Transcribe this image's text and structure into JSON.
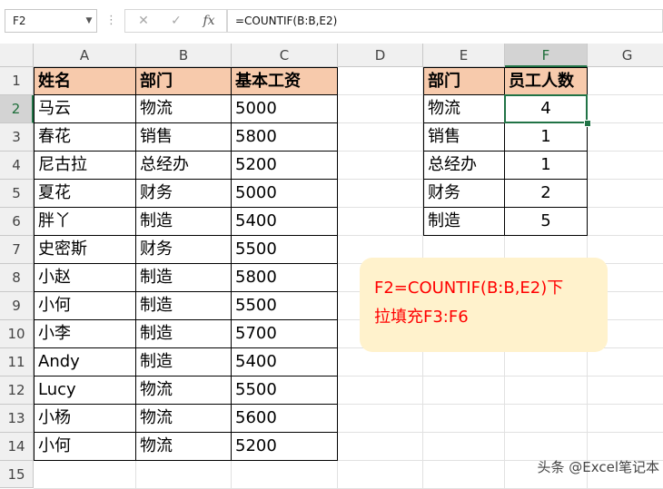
{
  "name_box": "F2",
  "formula_bar": {
    "cancel_icon": "✕",
    "enter_icon": "✓",
    "fx_label": "fx",
    "formula": "=COUNTIF(B:B,E2)"
  },
  "columns": [
    "A",
    "B",
    "C",
    "D",
    "E",
    "F",
    "G"
  ],
  "rows": [
    "1",
    "2",
    "3",
    "4",
    "5",
    "6",
    "7",
    "8",
    "9",
    "10",
    "11",
    "12",
    "13",
    "14",
    "15"
  ],
  "table1": {
    "headers": [
      "姓名",
      "部门",
      "基本工资"
    ],
    "rows": [
      [
        "马云",
        "物流",
        "5000"
      ],
      [
        "春花",
        "销售",
        "5800"
      ],
      [
        "尼古拉",
        "总经办",
        "5200"
      ],
      [
        "夏花",
        "财务",
        "5000"
      ],
      [
        "胖丫",
        "制造",
        "5400"
      ],
      [
        "史密斯",
        "财务",
        "5500"
      ],
      [
        "小赵",
        "制造",
        "5800"
      ],
      [
        "小何",
        "制造",
        "5500"
      ],
      [
        "小李",
        "制造",
        "5700"
      ],
      [
        "Andy",
        "制造",
        "5400"
      ],
      [
        "Lucy",
        "物流",
        "5500"
      ],
      [
        "小杨",
        "物流",
        "5600"
      ],
      [
        "小何",
        "物流",
        "5200"
      ]
    ]
  },
  "table2": {
    "headers": [
      "部门",
      "员工人数"
    ],
    "rows": [
      [
        "物流",
        "4"
      ],
      [
        "销售",
        "1"
      ],
      [
        "总经办",
        "1"
      ],
      [
        "财务",
        "2"
      ],
      [
        "制造",
        "5"
      ]
    ]
  },
  "selected_cell": "F2",
  "note": {
    "line1": "F2=COUNTIF(B:B,E2)下",
    "line2": "拉填充F3:F6"
  },
  "watermark": "头条 @Excel笔记本",
  "colors": {
    "header_fill": "#f7caac",
    "selection": "#217346",
    "note_bg": "#fff2cc",
    "note_text": "#ff0000"
  }
}
